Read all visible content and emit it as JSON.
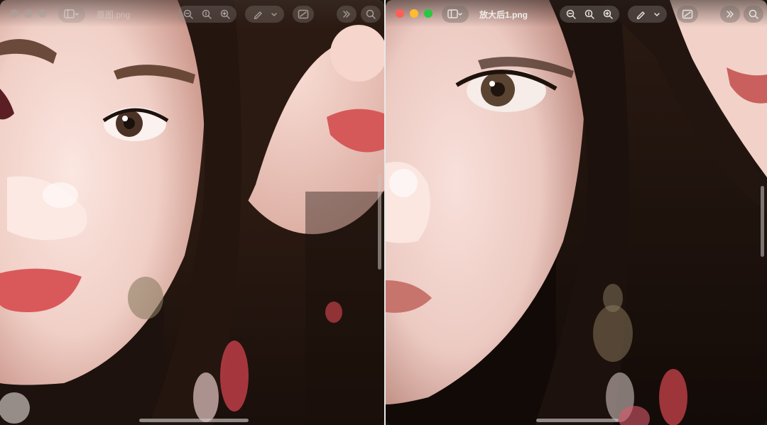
{
  "left_window": {
    "title": "原图.png",
    "active": false,
    "toolbar": {
      "sidebar_icon": "sidebar-toggle-icon",
      "zoom_out_icon": "zoom-out-icon",
      "actual_size_icon": "zoom-actual-size-icon",
      "zoom_in_icon": "zoom-in-icon",
      "markup_icon": "markup-pen-icon",
      "crop_icon": "crop-adjust-icon",
      "more_icon": "more-chevrons-icon",
      "search_icon": "search-icon"
    }
  },
  "right_window": {
    "title": "放大后1.png",
    "active": true,
    "toolbar": {
      "sidebar_icon": "sidebar-toggle-icon",
      "zoom_out_icon": "zoom-out-icon",
      "actual_size_icon": "zoom-actual-size-icon",
      "zoom_in_icon": "zoom-in-icon",
      "markup_icon": "markup-pen-icon",
      "crop_icon": "crop-adjust-icon",
      "more_icon": "more-chevrons-icon",
      "search_icon": "search-icon"
    }
  },
  "colors": {
    "skin": "#f4d4cc",
    "hair": "#2a1a14",
    "lips": "#d8605a",
    "close": "#ff5f57",
    "minimize": "#febc2e",
    "zoom": "#28c840"
  }
}
